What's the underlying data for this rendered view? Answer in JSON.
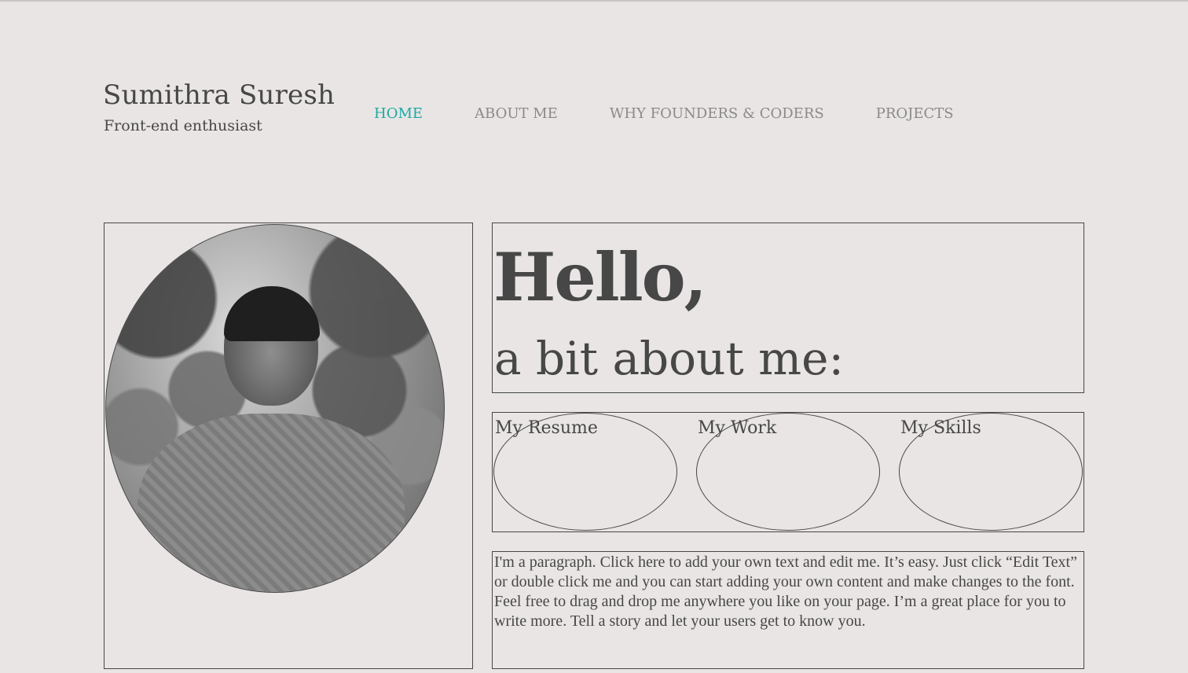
{
  "header": {
    "site_name": "Sumithra Suresh",
    "tagline": "Front-end enthusiast"
  },
  "nav": {
    "items": [
      {
        "label": "HOME",
        "active": true
      },
      {
        "label": "ABOUT ME",
        "active": false
      },
      {
        "label": "WHY FOUNDERS & CODERS",
        "active": false
      },
      {
        "label": "PROJECTS",
        "active": false
      }
    ],
    "active_color": "#1aaaa3",
    "inactive_color": "#8a8a8a"
  },
  "hero": {
    "title": "Hello,",
    "subtitle": "a bit about me:"
  },
  "links": [
    {
      "label": "My Resume"
    },
    {
      "label": "My Work"
    },
    {
      "label": "My Skills"
    }
  ],
  "paragraph": {
    "text": "I'm a paragraph. Click here to add your own text and edit me. It’s easy. Just click “Edit Text” or double click me and you can start adding your own content and make changes to the font. Feel free to drag and drop me anywhere you like on your page. I’m a great place for you to write more. Tell a story and let your users get to know you."
  },
  "colors": {
    "background": "#e8e5e4",
    "text": "#474747"
  }
}
